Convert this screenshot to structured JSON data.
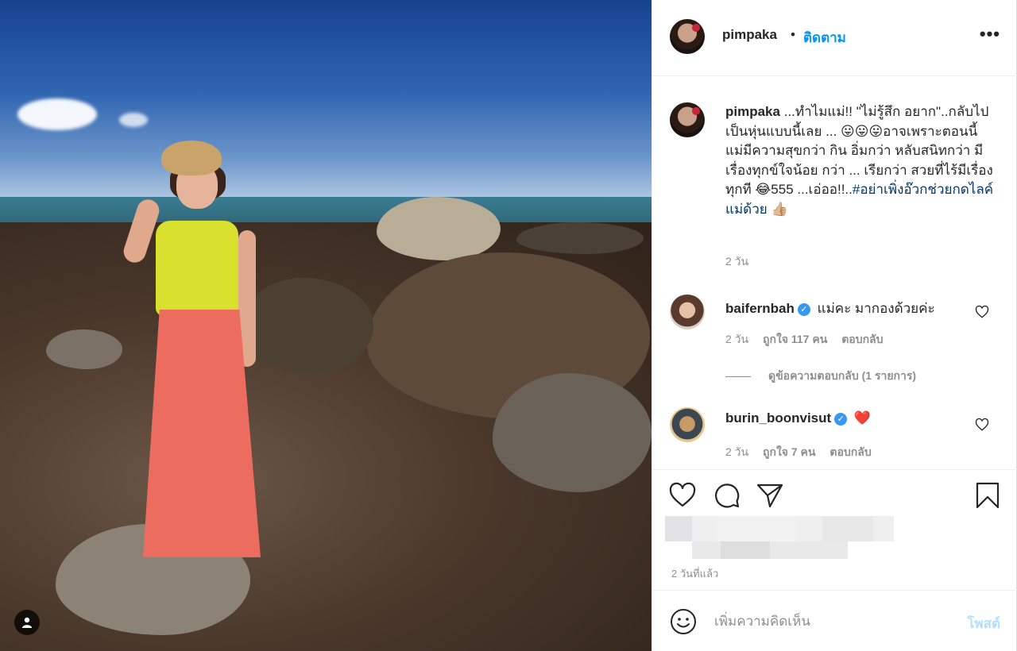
{
  "post": {
    "username": "pimpaka",
    "separator": "•",
    "follow_label": "ติดตาม",
    "more_label": "•••"
  },
  "caption": {
    "username": "pimpaka",
    "text": "...ทำไมแม่!! \"ไม่รู้สึก อยาก\"..กลับไปเป็นหุ่นแบบนี้เลย ... 😛😛😛อาจเพราะตอนนี้ แม่มีความสุขกว่า กิน อิ่มกว่า หลับสนิทกว่า มีเรื่องทุกข์ใจน้อย กว่า ... เรียกว่า สวยที่ไร้มีเรื่องทุกที 😂555 ...เอ่ออ!!..",
    "hashtag": "#อย่าเพิ่งอ๊วกช่วยกดไลค์แม่ด้วย",
    "emoji_end": "👍🏼",
    "time": "2 วัน"
  },
  "comments": [
    {
      "username": "baifernbah",
      "verified": true,
      "text": "แม่คะ มากองด้วยค่ะ",
      "time": "2 วัน",
      "likes": "ถูกใจ 117 คน",
      "reply_label": "ตอบกลับ"
    },
    {
      "username": "burin_boonvisut",
      "verified": true,
      "text": "❤️",
      "time": "2 วัน",
      "likes": "ถูกใจ 7 คน",
      "reply_label": "ตอบกลับ"
    }
  ],
  "view_replies_label": "ดูข้อความตอบกลับ (1 รายการ)",
  "post_time": "2 วันที่แล้ว",
  "add_comment": {
    "placeholder": "เพิ่มความคิดเห็น",
    "post_label": "โพสต์"
  },
  "icons": {
    "like": "heart-icon",
    "comment": "comment-icon",
    "share": "paper-plane-icon",
    "save": "bookmark-icon",
    "emoji": "smiley-icon",
    "user_tag": "person-icon"
  },
  "colors": {
    "link_blue": "#0095f6",
    "hashtag": "#00376b",
    "muted": "#8e8e8e",
    "verified": "#3897f0",
    "post_disabled": "#b2dffc"
  }
}
